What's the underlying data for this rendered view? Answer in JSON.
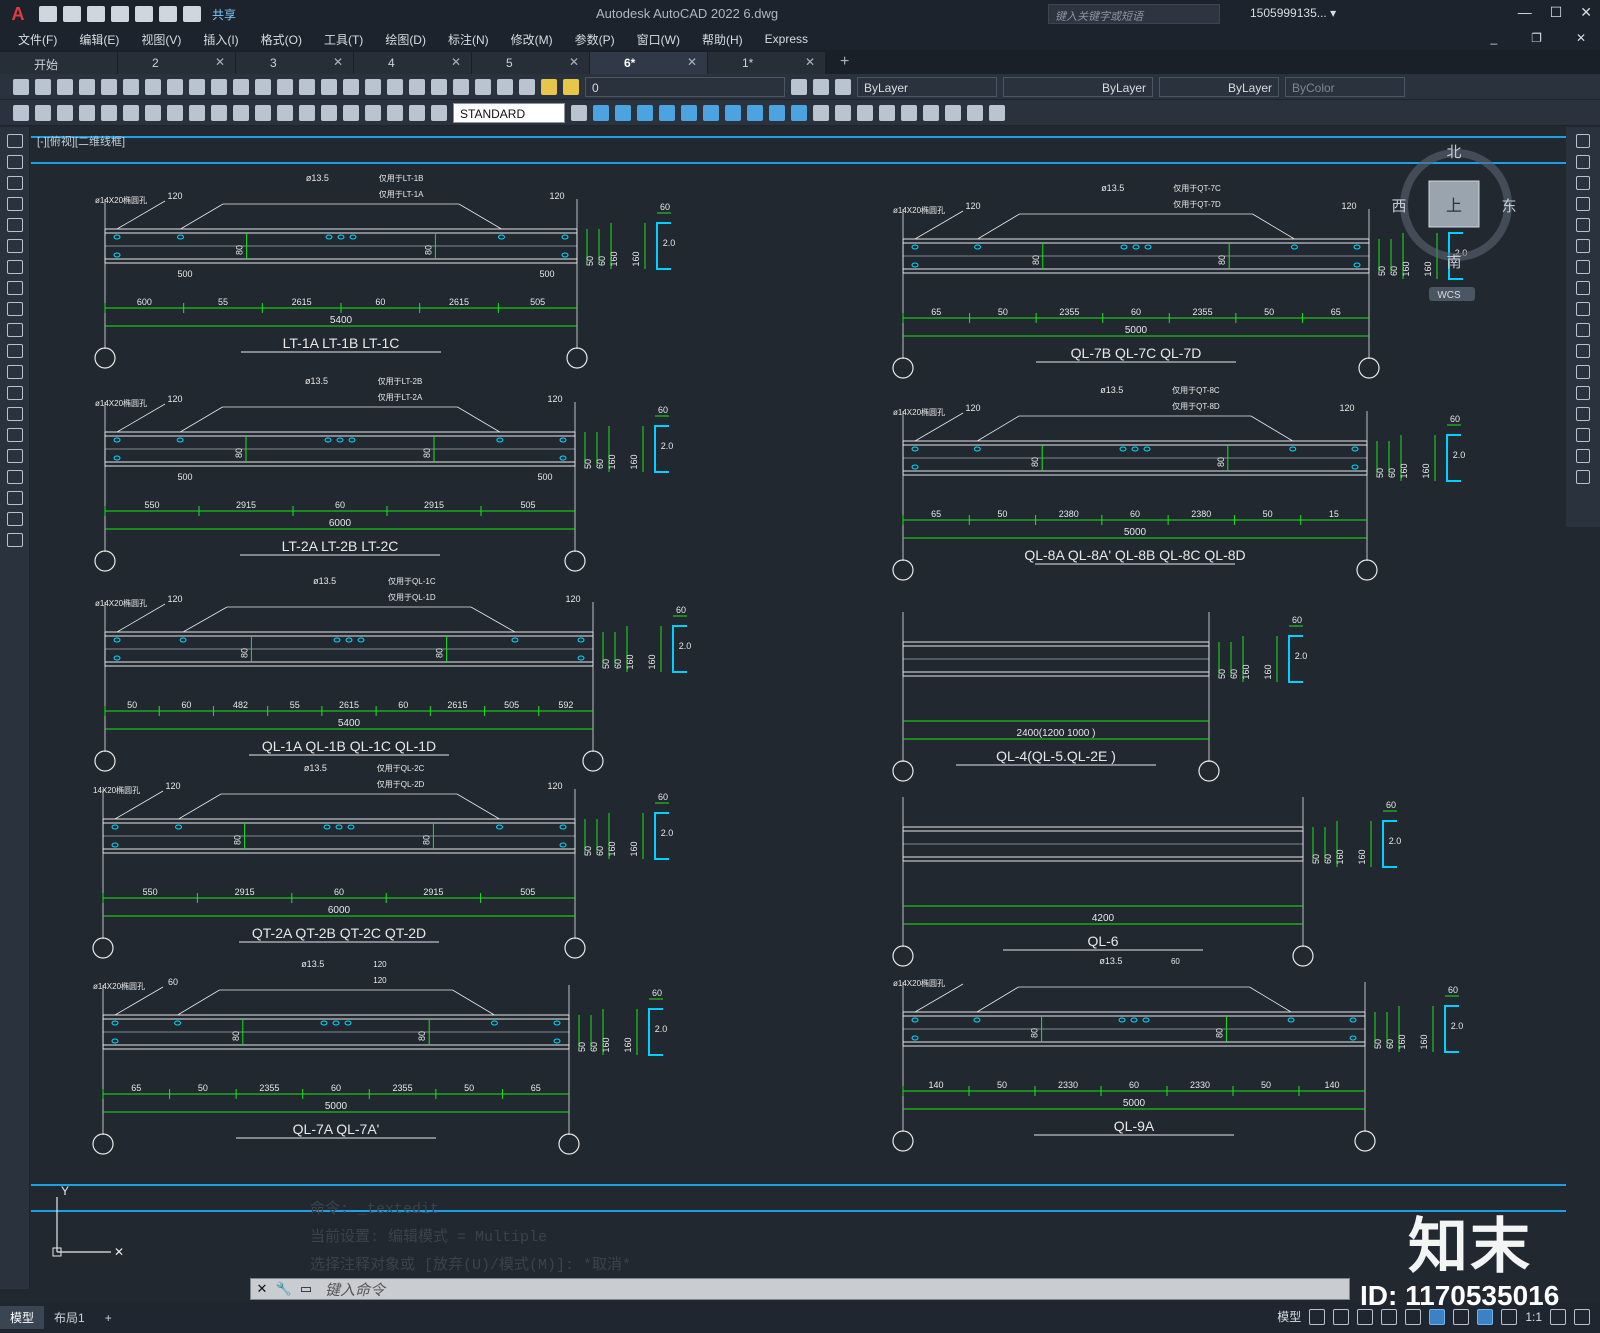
{
  "app": {
    "title": "Autodesk AutoCAD 2022    6.dwg",
    "share": "共享",
    "search_placeholder": "键入关键字或短语",
    "user": "1505999135... ▾"
  },
  "menu": [
    "文件(F)",
    "编辑(E)",
    "视图(V)",
    "插入(I)",
    "格式(O)",
    "工具(T)",
    "绘图(D)",
    "标注(N)",
    "修改(M)",
    "参数(P)",
    "窗口(W)",
    "帮助(H)",
    "Express"
  ],
  "tabs": [
    {
      "label": "开始",
      "active": false
    },
    {
      "label": "2",
      "active": false
    },
    {
      "label": "3",
      "active": false
    },
    {
      "label": "4",
      "active": false
    },
    {
      "label": "5",
      "active": false
    },
    {
      "label": "6*",
      "active": true
    },
    {
      "label": "1*",
      "active": false
    }
  ],
  "toolbar": {
    "layer": "0",
    "color": "ByLayer",
    "linetype": "ByLayer",
    "lineweight": "ByLayer",
    "plotstyle": "ByColor",
    "textstyle": "STANDARD"
  },
  "view_control": "[-][俯视][二维线框]",
  "viewcube": {
    "north": "北",
    "south": "南",
    "east": "东",
    "west": "西",
    "face": "上",
    "wcs": "WCS"
  },
  "drawings_left": [
    {
      "title": "LT-1A  LT-1B  LT-1C",
      "total": "5400",
      "segs": [
        "600",
        "55",
        "2615",
        "60",
        "2615",
        "505"
      ],
      "holes": [
        "ø14X20椭圆孔",
        "ø13.5",
        "仅用于LT-1B",
        "仅用于LT-1A",
        "120",
        "120",
        "500",
        "500"
      ]
    },
    {
      "title": "LT-2A  LT-2B  LT-2C",
      "total": "6000",
      "segs": [
        "550",
        "2915",
        "60",
        "2915",
        "505"
      ],
      "holes": [
        "ø14X20椭圆孔",
        "ø13.5",
        "仅用于LT-2B",
        "仅用于LT-2A",
        "120",
        "120",
        "500",
        "500"
      ]
    },
    {
      "title": "QL-1A  QL-1B  QL-1C  QL-1D",
      "total": "5400",
      "segs": [
        "50",
        "60",
        "482",
        "55",
        "2615",
        "60",
        "2615",
        "505",
        "592"
      ],
      "holes": [
        "ø14X20椭圆孔",
        "ø13.5",
        "仅用于QL-1C",
        "仅用于QL-1D",
        "120",
        "120"
      ]
    },
    {
      "title": "QT-2A  QT-2B  QT-2C  QT-2D",
      "total": "6000",
      "segs": [
        "550",
        "2915",
        "60",
        "2915",
        "505"
      ],
      "holes": [
        "14X20椭圆孔",
        "ø13.5",
        "仅用于QL-2C",
        "仅用于QL-2D",
        "120",
        "120"
      ]
    },
    {
      "title": "QL-7A  QL-7A'",
      "total": "5000",
      "segs": [
        "65",
        "50",
        "2355",
        "60",
        "2355",
        "50",
        "65"
      ],
      "holes": [
        "ø14X20椭圆孔",
        "ø13.5",
        "120",
        "120",
        "60"
      ]
    }
  ],
  "drawings_right": [
    {
      "title": "QL-7B  QL-7C  QL-7D",
      "total": "5000",
      "segs": [
        "65",
        "50",
        "2355",
        "60",
        "2355",
        "50",
        "65"
      ],
      "holes": [
        "ø14X20椭圆孔",
        "ø13.5",
        "仅用于QT-7C",
        "仅用于QT-7D",
        "120",
        "120"
      ]
    },
    {
      "title": "QL-8A  QL-8A' QL-8B  QL-8C  QL-8D",
      "total": "5000",
      "segs": [
        "65",
        "50",
        "2380",
        "60",
        "2380",
        "50",
        "15"
      ],
      "holes": [
        "ø14X20椭圆孔",
        "ø13.5",
        "仅用于QT-8C",
        "仅用于QT-8D",
        "120",
        "120"
      ]
    },
    {
      "title": "QL-4(QL-5.QL-2E )",
      "total": "2400(1200 1000 )",
      "segs": [],
      "holes": []
    },
    {
      "title": "QL-6",
      "total": "4200",
      "segs": [],
      "holes": []
    },
    {
      "title": "QL-9A",
      "total": "5000",
      "segs": [
        "140",
        "50",
        "2330",
        "60",
        "2330",
        "50",
        "140"
      ],
      "holes": [
        "ø14X20椭圆孔",
        "ø13.5",
        "60"
      ]
    }
  ],
  "section_labels": {
    "w": "60",
    "h": "160",
    "t": "2.0",
    "d1": "50",
    "d2": "60",
    "d3": "50",
    "mid": "80"
  },
  "command_history": [
    "命令: _textedit",
    "当前设置: 编辑模式 = Multiple",
    "选择注释对象或 [放弃(U)/模式(M)]: *取消*"
  ],
  "command_placeholder": "键入命令",
  "layout_tabs": [
    "模型",
    "布局1"
  ],
  "status": {
    "model": "模型",
    "scale": "1:1"
  },
  "watermark": {
    "logo": "知末",
    "id": "ID: 1170535016"
  },
  "colors": {
    "canvas_bg": "#212830",
    "dim_green": "#19e619",
    "geom_white": "#e8e8e8",
    "hole_cyan": "#00d8ff",
    "section_cyan": "#00d0ff",
    "frame_blue": "#1ea0e6"
  }
}
